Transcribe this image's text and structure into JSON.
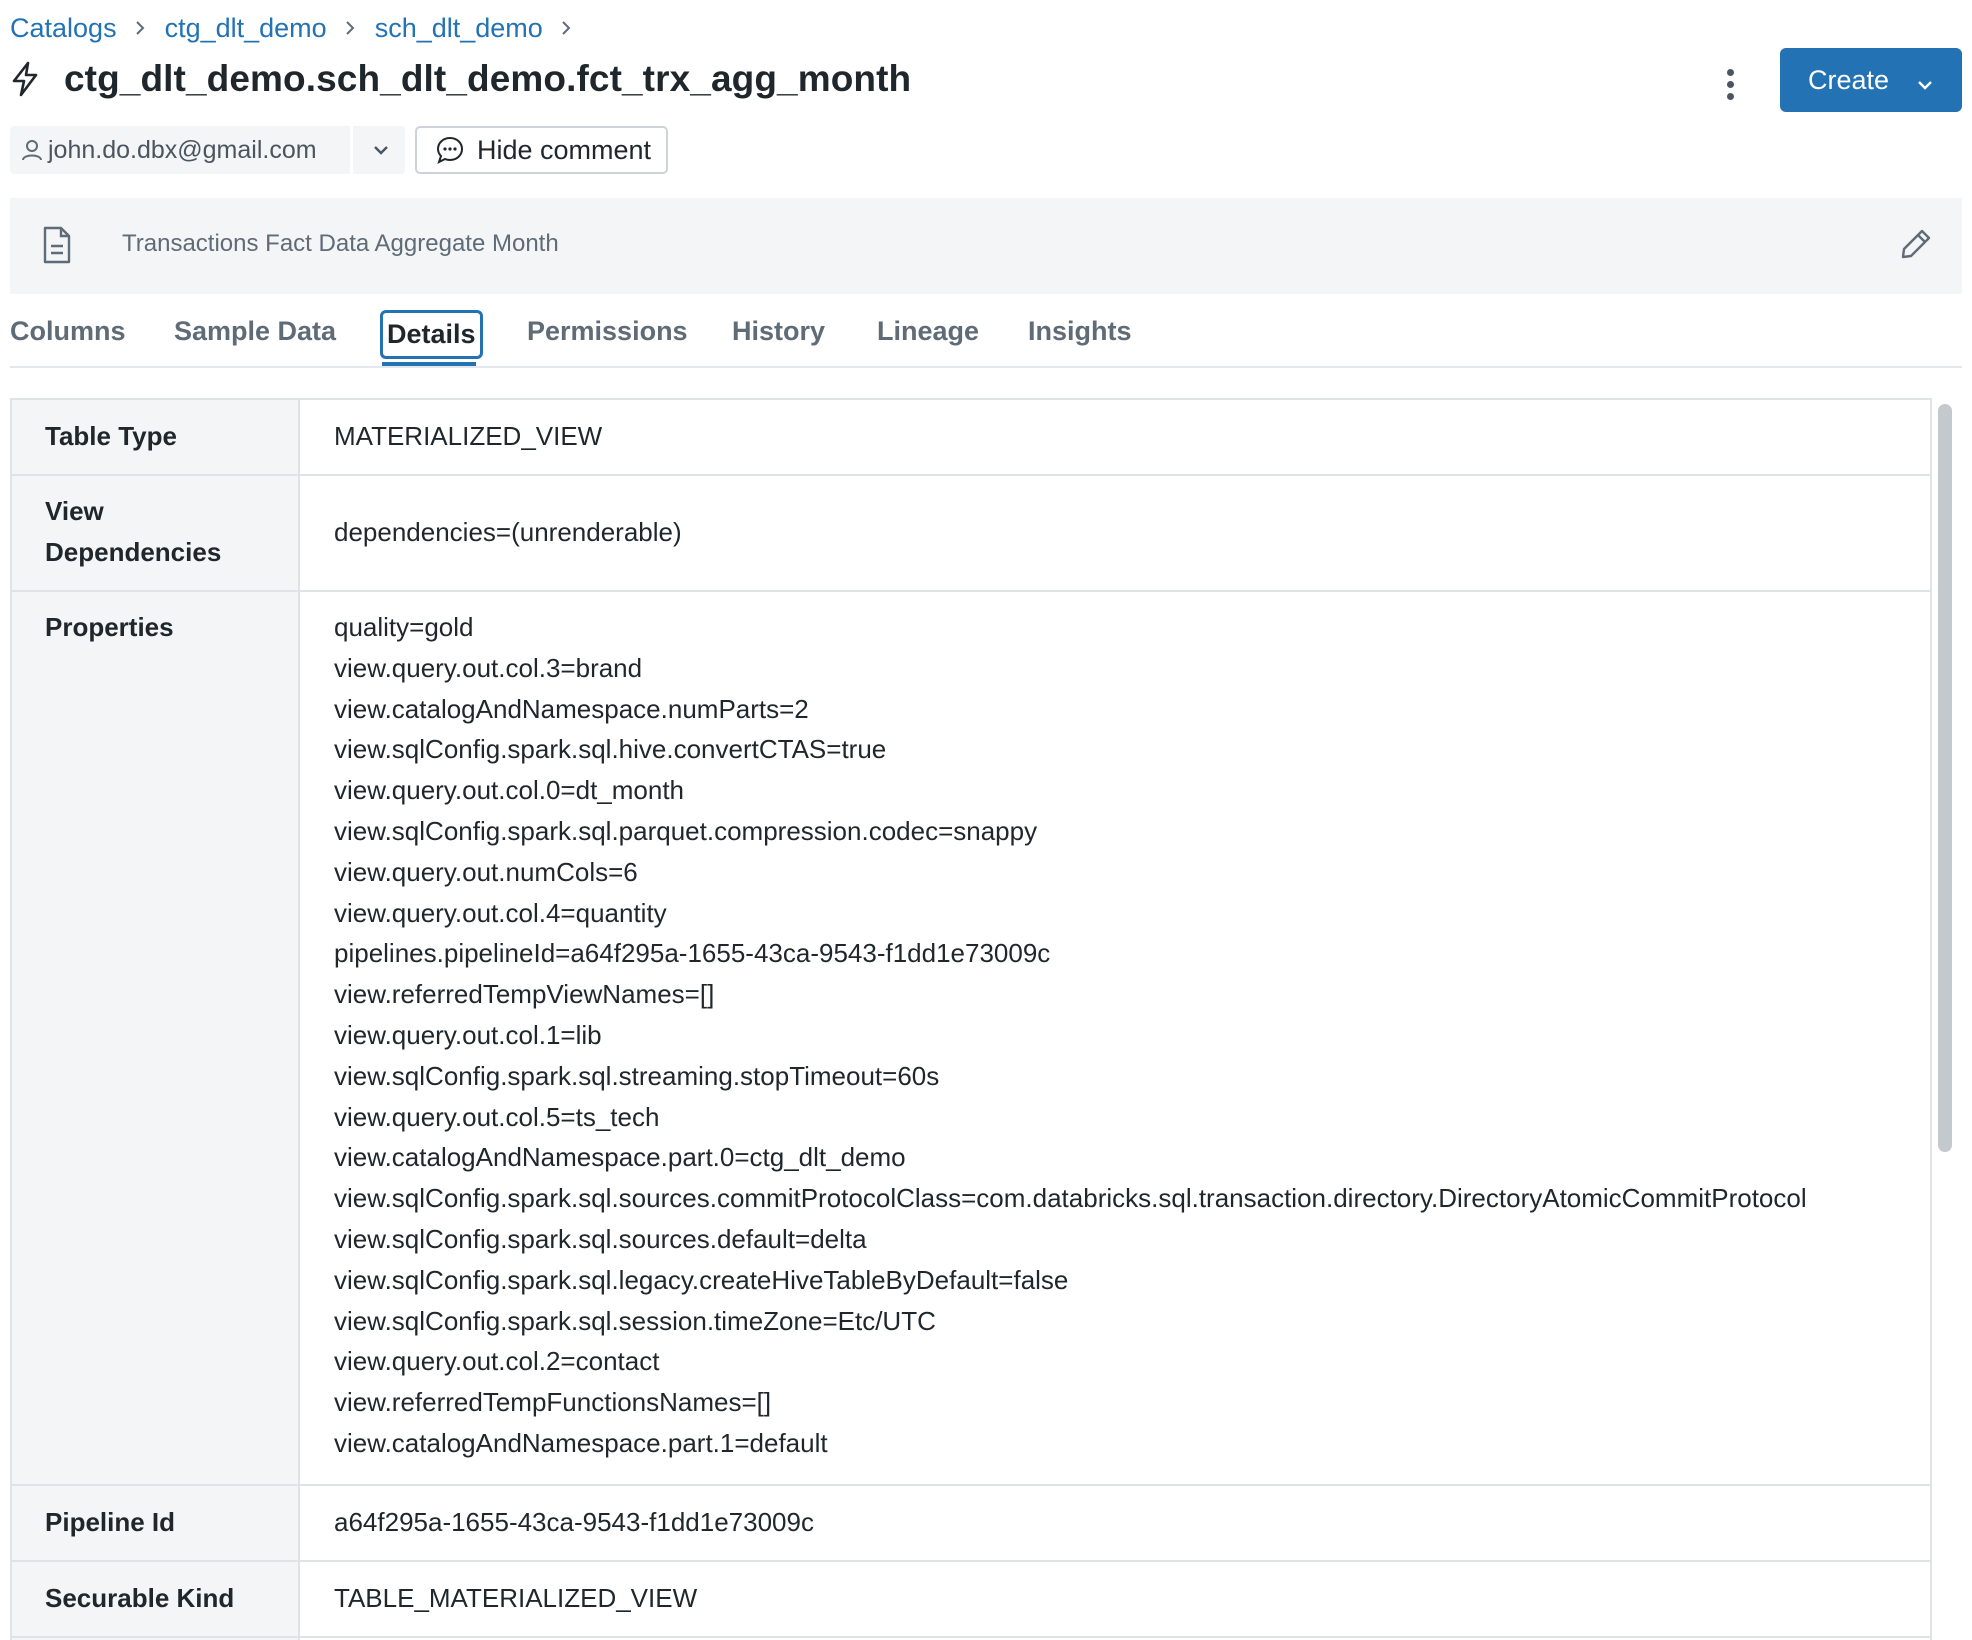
{
  "breadcrumb": {
    "items": [
      "Catalogs",
      "ctg_dlt_demo",
      "sch_dlt_demo"
    ]
  },
  "header": {
    "title": "ctg_dlt_demo.sch_dlt_demo.fct_trx_agg_month",
    "title_icon": "lightning-icon",
    "create_label": "Create"
  },
  "owner": {
    "email": "john.do.dbx@gmail.com"
  },
  "comment": {
    "toggle_label": "Hide comment",
    "text": "Transactions Fact Data Aggregate Month"
  },
  "tabs": [
    {
      "label": "Columns",
      "active": false
    },
    {
      "label": "Sample Data",
      "active": false
    },
    {
      "label": "Details",
      "active": true
    },
    {
      "label": "Permissions",
      "active": false
    },
    {
      "label": "History",
      "active": false
    },
    {
      "label": "Lineage",
      "active": false
    },
    {
      "label": "Insights",
      "active": false
    }
  ],
  "details": {
    "table_type": {
      "key": "Table Type",
      "value": "MATERIALIZED_VIEW"
    },
    "view_dependencies": {
      "key_line1": "View",
      "key_line2": "Dependencies",
      "value": "dependencies=(unrenderable)"
    },
    "properties": {
      "key": "Properties",
      "values": [
        "quality=gold",
        "view.query.out.col.3=brand",
        "view.catalogAndNamespace.numParts=2",
        "view.sqlConfig.spark.sql.hive.convertCTAS=true",
        "view.query.out.col.0=dt_month",
        "view.sqlConfig.spark.sql.parquet.compression.codec=snappy",
        "view.query.out.numCols=6",
        "view.query.out.col.4=quantity",
        "pipelines.pipelineId=a64f295a-1655-43ca-9543-f1dd1e73009c",
        "view.referredTempViewNames=[]",
        "view.query.out.col.1=lib",
        "view.sqlConfig.spark.sql.streaming.stopTimeout=60s",
        "view.query.out.col.5=ts_tech",
        "view.catalogAndNamespace.part.0=ctg_dlt_demo",
        "view.sqlConfig.spark.sql.sources.commitProtocolClass=com.databricks.sql.transaction.directory.DirectoryAtomicCommitProtocol",
        "view.sqlConfig.spark.sql.sources.default=delta",
        "view.sqlConfig.spark.sql.legacy.createHiveTableByDefault=false",
        "view.sqlConfig.spark.sql.session.timeZone=Etc/UTC",
        "view.query.out.col.2=contact",
        "view.referredTempFunctionsNames=[]",
        "view.catalogAndNamespace.part.1=default"
      ]
    },
    "pipeline_id": {
      "key": "Pipeline Id",
      "value": "a64f295a-1655-43ca-9543-f1dd1e73009c"
    },
    "securable_kind": {
      "key": "Securable Kind",
      "value": "TABLE_MATERIALIZED_VIEW"
    }
  },
  "colors": {
    "accent": "#2272b4",
    "panel_bg": "#f3f5f7",
    "border": "#dfe3e7"
  }
}
